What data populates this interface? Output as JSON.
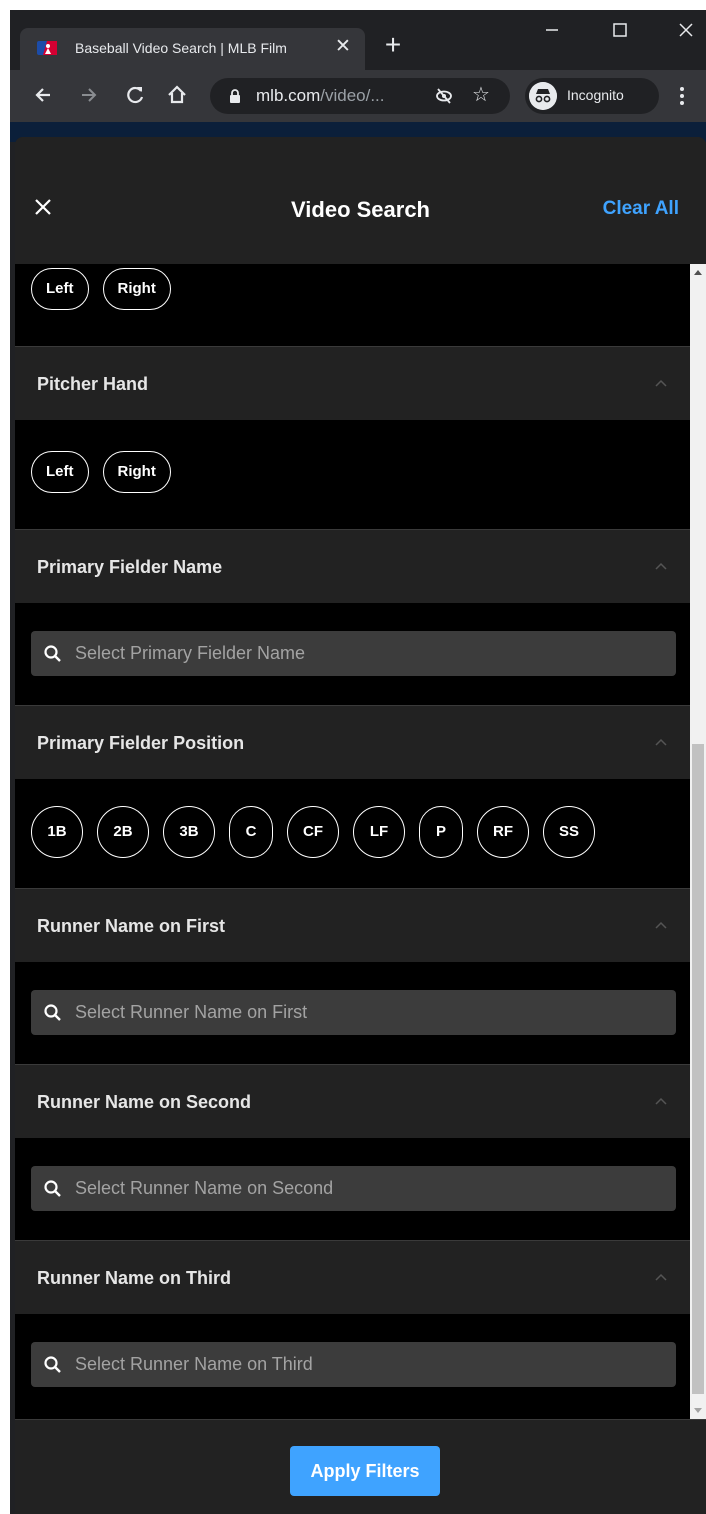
{
  "browser": {
    "tab_title": "Baseball Video Search | MLB Film",
    "url_main": "mlb.com",
    "url_rest": "/video/...",
    "incognito_label": "Incognito"
  },
  "modal": {
    "title": "Video Search",
    "close_icon": "close-icon",
    "clear_all": "Clear All",
    "apply_label": "Apply Filters",
    "accent_color": "#3fa3ff"
  },
  "sections": {
    "batter_hand": {
      "options": [
        "Left",
        "Right"
      ]
    },
    "pitcher_hand": {
      "title": "Pitcher Hand",
      "options": [
        "Left",
        "Right"
      ]
    },
    "primary_fielder_name": {
      "title": "Primary Fielder Name",
      "placeholder": "Select Primary Fielder Name"
    },
    "primary_fielder_position": {
      "title": "Primary Fielder Position",
      "options": [
        "1B",
        "2B",
        "3B",
        "C",
        "CF",
        "LF",
        "P",
        "RF",
        "SS"
      ]
    },
    "runner_first": {
      "title": "Runner Name on First",
      "placeholder": "Select Runner Name on First"
    },
    "runner_second": {
      "title": "Runner Name on Second",
      "placeholder": "Select Runner Name on Second"
    },
    "runner_third": {
      "title": "Runner Name on Third",
      "placeholder": "Select Runner Name on Third"
    }
  }
}
